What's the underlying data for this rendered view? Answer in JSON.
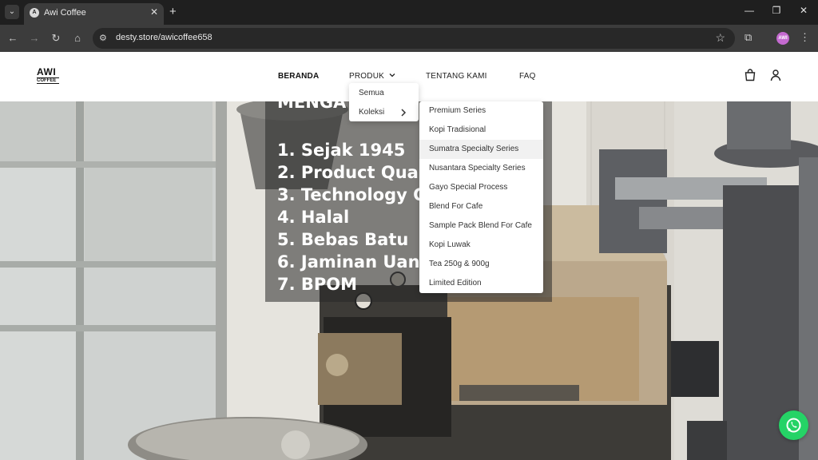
{
  "browser": {
    "tab_title": "Awi Coffee",
    "favicon_text": "A",
    "url": "desty.store/awicoffee658",
    "profile_initials": "AWI"
  },
  "site": {
    "logo_top": "AWI",
    "logo_bottom": "COFFEE",
    "menu": {
      "home": "BERANDA",
      "products": "PRODUK",
      "about": "TENTANG KAMI",
      "faq": "FAQ"
    },
    "products_dropdown": {
      "all": "Semua",
      "collections": "Koleksi"
    },
    "collections": [
      "Premium Series",
      "Kopi Tradisional",
      "Sumatra Specialty Series",
      "Nusantara Specialty Series",
      "Gayo Special Process",
      "Blend For Cafe",
      "Sample Pack Blend For Cafe",
      "Kopi Luwak",
      "Tea 250g & 900g",
      "Limited Edition"
    ]
  },
  "hero": {
    "heading_partial": "MENGA",
    "lines": [
      "1. Sejak 1945",
      "2. Product Qua",
      "3. Technology C",
      "4. Halal",
      "5. Bebas Batu",
      "6. Jaminan Uan",
      "7. BPOM"
    ]
  },
  "colors": {
    "whatsapp": "#25d366",
    "browser_dark": "#1f1f1f"
  }
}
